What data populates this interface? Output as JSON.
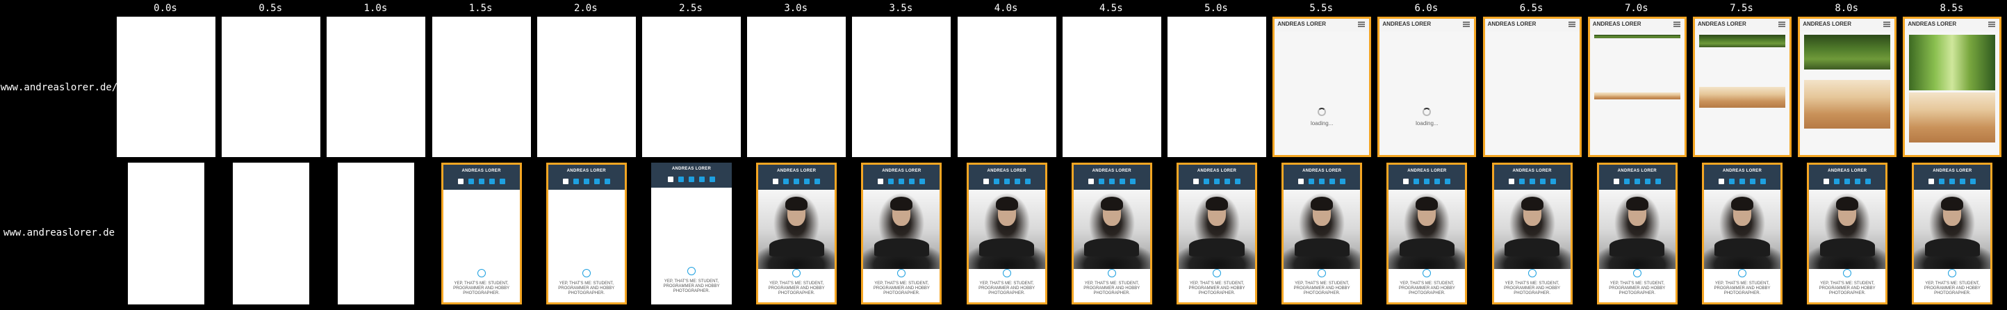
{
  "times": [
    "0.0s",
    "0.5s",
    "1.0s",
    "1.5s",
    "2.0s",
    "2.5s",
    "3.0s",
    "3.5s",
    "4.0s",
    "4.5s",
    "5.0s",
    "5.5s",
    "6.0s",
    "6.5s",
    "7.0s",
    "7.5s",
    "8.0s",
    "8.5s"
  ],
  "rows": [
    {
      "label": "www.andreaslorer.de/"
    },
    {
      "label": "www.andreaslorer.de"
    }
  ],
  "site1": {
    "title": "ANDREAS LORER",
    "loading": "loading..."
  },
  "site2": {
    "title": "ANDREAS LORER",
    "tagline": "YEP, THAT'S ME: STUDENT, PROGRAMMER AND HOBBY PHOTOGRAPHER."
  },
  "highlight_color": "#f5a623"
}
